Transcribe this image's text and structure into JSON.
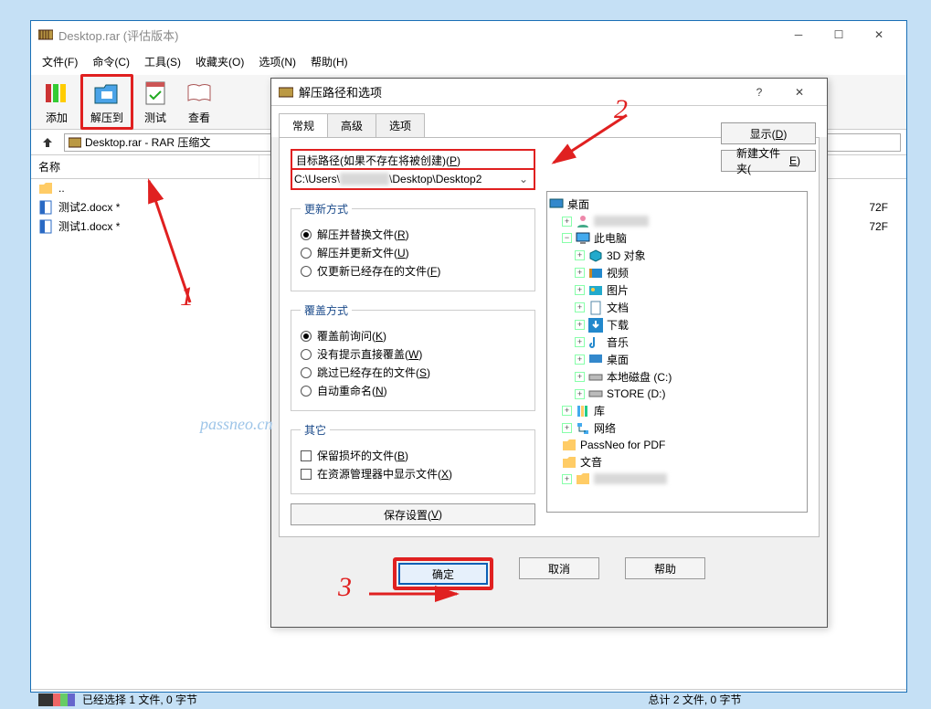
{
  "main": {
    "title": "Desktop.rar (评估版本)",
    "menu": [
      "文件(F)",
      "命令(C)",
      "工具(S)",
      "收藏夹(O)",
      "选项(N)",
      "帮助(H)"
    ],
    "toolbar": {
      "add": "添加",
      "extract": "解压到",
      "test": "测试",
      "view": "查看"
    },
    "path": "Desktop.rar - RAR 压缩文",
    "col_name": "名称",
    "files": {
      "up": "..",
      "f1": "测试2.docx *",
      "f2": "测试1.docx *"
    },
    "file_attr": "72F",
    "status_left": "已经选择 1 文件, 0 字节",
    "status_right": "总计 2 文件, 0 字节"
  },
  "dlg": {
    "title": "解压路径和选项",
    "help_q": "?",
    "tabs": {
      "general": "常规",
      "advanced": "高级",
      "options": "选项"
    },
    "path_label": "目标路径(如果不存在将被创建)(P)",
    "path_value": "C:\\Users\\",
    "path_value2": "\\Desktop\\Desktop2",
    "btn_show": "显示(D)",
    "btn_newfolder": "新建文件夹(E)",
    "grp_update": "更新方式",
    "upd": {
      "a": "解压并替换文件(R)",
      "b": "解压并更新文件(U)",
      "c": "仅更新已经存在的文件(F)"
    },
    "grp_over": "覆盖方式",
    "ov": {
      "a": "覆盖前询问(K)",
      "b": "没有提示直接覆盖(W)",
      "c": "跳过已经存在的文件(S)",
      "d": "自动重命名(N)"
    },
    "grp_misc": "其它",
    "misc": {
      "a": "保留损坏的文件(B)",
      "b": "在资源管理器中显示文件(X)"
    },
    "btn_save": "保存设置(V)",
    "tree": {
      "desktop": "桌面",
      "user": "",
      "thispc": "此电脑",
      "3d": "3D 对象",
      "video": "视频",
      "pic": "图片",
      "doc": "文档",
      "dl": "下载",
      "music": "音乐",
      "desk2": "桌面",
      "cdisk": "本地磁盘 (C:)",
      "ddisk": "STORE (D:)",
      "lib": "库",
      "net": "网络",
      "pn": "PassNeo for PDF",
      "wy": "文音",
      "blank": ""
    },
    "btn_ok": "确定",
    "btn_cancel": "取消",
    "btn_help": "帮助"
  },
  "anno": {
    "n1": "1",
    "n2": "2",
    "n3": "3",
    "wm": "passneo.cn"
  }
}
